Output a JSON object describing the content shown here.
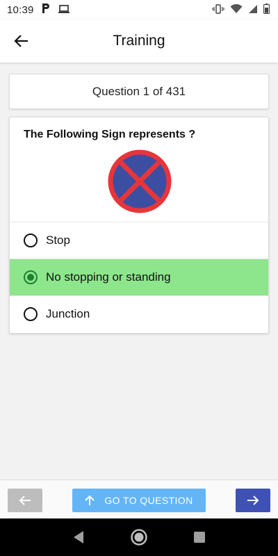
{
  "status_bar": {
    "time": "10:39",
    "left_icons": [
      "p-notification-icon",
      "laptop-icon"
    ],
    "right_icons": [
      "vibrate-icon",
      "wifi-icon",
      "signal-icon",
      "battery-icon"
    ]
  },
  "app_bar": {
    "title": "Training"
  },
  "counter": {
    "text": "Question 1 of 431"
  },
  "question": {
    "text": "The Following Sign represents ?",
    "sign_icon": "no-stopping-sign-icon",
    "options": [
      {
        "label": "Stop",
        "selected": false
      },
      {
        "label": "No stopping or standing",
        "selected": true
      },
      {
        "label": "Junction",
        "selected": false
      }
    ]
  },
  "toolbar": {
    "goto_label": "GO TO QUESTION"
  },
  "colors": {
    "selected_option": "#8ee68c",
    "prev_button": "#bdbdbd",
    "goto_button": "#64b5f6",
    "next_button": "#3f51b5",
    "sign_red": "#e8353a",
    "sign_blue": "#3b4ea2"
  }
}
